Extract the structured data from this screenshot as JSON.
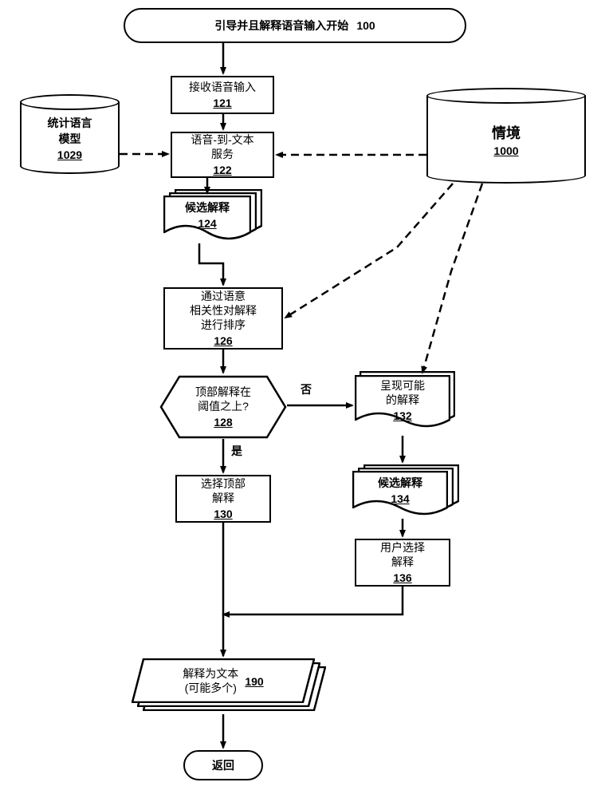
{
  "title_bar": {
    "text": "引导并且解释语音输入开始",
    "ref": "100"
  },
  "cylinders": {
    "left": {
      "text": "统计语言\n模型",
      "ref": "1029"
    },
    "right": {
      "text": "情境",
      "ref": "1000"
    }
  },
  "steps": {
    "receive": {
      "text": "接收语音输入",
      "ref": "121"
    },
    "stt": {
      "text": "语音-到-文本\n服务",
      "ref": "122"
    },
    "candidates1": {
      "text": "候选解释",
      "ref": "124"
    },
    "rank": {
      "text": "通过语意\n相关性对解释\n进行排序",
      "ref": "126"
    },
    "decision": {
      "text": "顶部解释在\n阈值之上?",
      "ref": "128"
    },
    "select_top": {
      "text": "选择顶部\n解释",
      "ref": "130"
    },
    "present": {
      "text": "呈现可能\n的解释",
      "ref": "132"
    },
    "candidates2": {
      "text": "候选解释",
      "ref": "134"
    },
    "user_select": {
      "text": "用户选择\n解释",
      "ref": "136"
    },
    "output": {
      "text": "解释为文本\n(可能多个)",
      "ref": "190"
    }
  },
  "terminators": {
    "return": "返回"
  },
  "decision_labels": {
    "yes": "是",
    "no": "否"
  }
}
